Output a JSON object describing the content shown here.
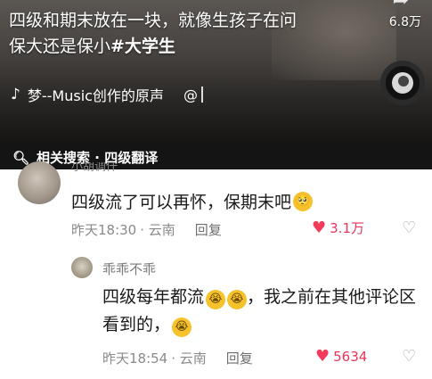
{
  "video": {
    "caption_line1": "四级和期末放在一块，就像生孩子在问",
    "caption_line2": "保大还是保小",
    "caption_tag": "#大学生",
    "like_count": "6.8万",
    "music_label": "梦--Music创作的原声",
    "mention": "@",
    "top_icon": "share-icon",
    "note_icon": "tiktok-note-icon"
  },
  "related_search": {
    "label": "相关搜索 · 四级翻译"
  },
  "comments": [
    {
      "author_cut": "小胡调仟",
      "text": "四级流了可以再怀，保期末吧",
      "emoji": "pleading-face",
      "time": "昨天18:30",
      "location": "· 云南",
      "reply": "回复",
      "likes": "3.1万"
    },
    {
      "author": "乖乖不乖",
      "text_part1": "四级每年都流",
      "text_part2": "，我之前在其他评论区看到的，",
      "emoji": "crying-face",
      "time": "昨天18:54",
      "location": "· 云南",
      "reply": "回复",
      "likes": "5634"
    }
  ],
  "colors": {
    "like_red": "#f23a5a",
    "meta_gray": "#8a8a8a",
    "emoji_yellow": "#f6c22c"
  }
}
